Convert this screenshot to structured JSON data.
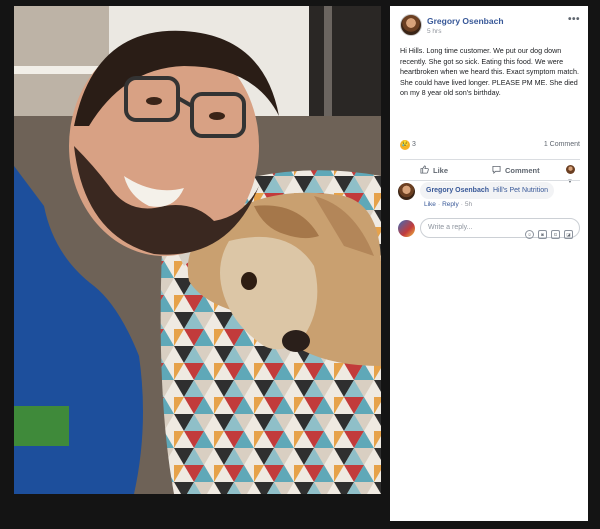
{
  "post": {
    "author": "Gregory Osenbach",
    "time": "5 hrs",
    "more_label": "•••",
    "text": "Hi Hills. Long time customer. We put our dog down recently. She got so sick. Eating this food. We were heartbroken when we heard this. Exact symptom match. She could have lived longer. PLEASE PM ME. She died on my 8 year old son's birthday.",
    "reaction_count": "3",
    "reaction_icon": "😢",
    "comment_count": "1 Comment"
  },
  "actions": {
    "like": "Like",
    "comment": "Comment"
  },
  "comment": {
    "author": "Gregory Osenbach",
    "text": "Hill's Pet Nutrition",
    "like": "Like",
    "reply": "Reply",
    "time": "5h"
  },
  "reply_box": {
    "placeholder": "Write a reply..."
  },
  "colors": {
    "link_blue": "#385898",
    "meta_gray": "#90949c",
    "divider": "#dadde1",
    "background": "#141414"
  }
}
